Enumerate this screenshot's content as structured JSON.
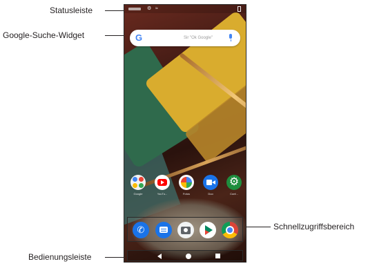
{
  "callouts": {
    "statusbar": "Statusleiste",
    "search_widget": "Google-Suche-Widget",
    "quick_access": "Schnellzugriffsbereich",
    "navigation": "Bedienungsleiste"
  },
  "search": {
    "logo": "G",
    "hint": "Sir \"Ok Google\""
  },
  "apps": [
    {
      "label": "Google",
      "icon": "google-folder-icon"
    },
    {
      "label": "YouTu...",
      "icon": "youtube-icon"
    },
    {
      "label": "Fotos",
      "icon": "photos-icon"
    },
    {
      "label": "Duo",
      "icon": "duo-icon"
    },
    {
      "label": "Conf...",
      "icon": "settings-icon"
    }
  ],
  "dock": [
    {
      "icon": "phone-icon"
    },
    {
      "icon": "messages-icon"
    },
    {
      "icon": "camera-icon"
    },
    {
      "icon": "play-store-icon"
    },
    {
      "icon": "chrome-icon"
    }
  ],
  "navbar": {
    "buttons": [
      "back-icon",
      "home-icon",
      "recents-icon"
    ]
  },
  "colors": {
    "google_blue": "#4285f4",
    "youtube_red": "#ff0000",
    "settings_green": "#1e8e3e",
    "callout_text": "#231f20"
  }
}
